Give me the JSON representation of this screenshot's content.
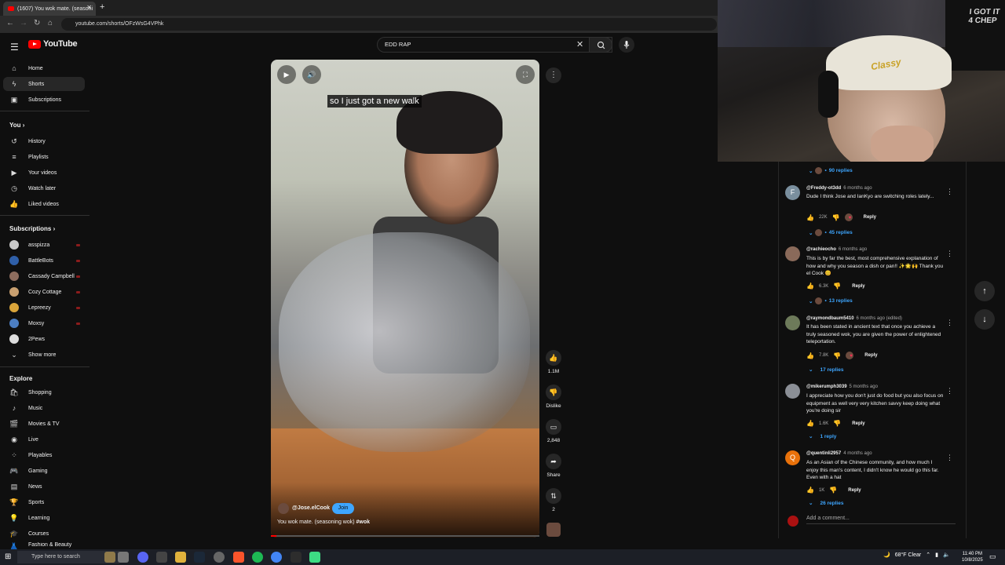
{
  "browser": {
    "tab_title": "(1607) You wok mate. (seasoni",
    "url": "youtube.com/shorts/OFzWsG4VPhk"
  },
  "sidebar": {
    "logo": "YouTube",
    "main": [
      {
        "label": "Home",
        "icon": "home-icon"
      },
      {
        "label": "Shorts",
        "icon": "shorts-icon"
      },
      {
        "label": "Subscriptions",
        "icon": "subscriptions-icon"
      }
    ],
    "you_heading": "You",
    "you": [
      {
        "label": "History",
        "icon": "history-icon"
      },
      {
        "label": "Playlists",
        "icon": "playlists-icon"
      },
      {
        "label": "Your videos",
        "icon": "your-videos-icon"
      },
      {
        "label": "Watch later",
        "icon": "watch-later-icon"
      },
      {
        "label": "Liked videos",
        "icon": "like-icon"
      }
    ],
    "subscriptions_heading": "Subscriptions",
    "subscriptions": [
      {
        "label": "asspizza",
        "color": "#c9c9c9"
      },
      {
        "label": "BattleBots",
        "color": "#2f5fa8"
      },
      {
        "label": "Cassady Campbell",
        "color": "#8e6d5e"
      },
      {
        "label": "Cozy Cottage",
        "color": "#c9a070"
      },
      {
        "label": "Lepreezy",
        "color": "#d9a43a"
      },
      {
        "label": "Moxsy",
        "color": "#4c7ec2"
      },
      {
        "label": "2Pews",
        "color": "#dddddd"
      }
    ],
    "show_more": "Show more",
    "explore_heading": "Explore",
    "explore": [
      {
        "label": "Shopping",
        "icon": "shopping-icon"
      },
      {
        "label": "Music",
        "icon": "music-icon"
      },
      {
        "label": "Movies & TV",
        "icon": "movies-icon"
      },
      {
        "label": "Live",
        "icon": "live-icon"
      },
      {
        "label": "Playables",
        "icon": "playables-icon"
      },
      {
        "label": "Gaming",
        "icon": "gaming-icon"
      },
      {
        "label": "News",
        "icon": "news-icon"
      },
      {
        "label": "Sports",
        "icon": "sports-icon"
      },
      {
        "label": "Learning",
        "icon": "learning-icon"
      },
      {
        "label": "Courses",
        "icon": "courses-icon"
      },
      {
        "label": "Fashion & Beauty",
        "icon": "fashion-icon"
      }
    ]
  },
  "search": {
    "value": "EDD RAP"
  },
  "video": {
    "caption": "so I just got a new walk",
    "channel": "@Jose.elCook",
    "join_label": "Join",
    "title": "You wok mate. (seasoning wok)",
    "hashtag": "#wok",
    "progress": 0.02
  },
  "actions": {
    "likes": "1.1M",
    "dislike": "Dislike",
    "comments": "2,848",
    "share": "Share",
    "remix": "2"
  },
  "comments": {
    "top_replies": "90 replies",
    "items": [
      {
        "user": "@Freddy-ot3dd",
        "time": "6 months ago",
        "text": "Dude I think Jose and IanKyo are switching roles lately...",
        "likes": "22K",
        "replies": "45 replies",
        "avatar_letter": "F",
        "avatar_color": "#7a8f9e",
        "hearted": true
      },
      {
        "user": "@rachieocho",
        "time": "6 months ago",
        "text": "This is by far the best, most comprehensive explanation of how and why you season a dish or pan!! ✨🌟🙌 Thank you el Cook 😊",
        "likes": "6.3K",
        "replies": "13 replies",
        "avatar_letter": "",
        "avatar_color": "#8a6a5a",
        "hearted": false
      },
      {
        "user": "@raymondbaum5410",
        "time": "6 months ago (edited)",
        "text": "It has been stated in ancient text that once you achieve a truly seasoned wok, you are given the power of enlightened teleportation.",
        "likes": "7.8K",
        "replies": "17 replies",
        "avatar_letter": "",
        "avatar_color": "#6d7a5a",
        "hearted": true
      },
      {
        "user": "@mikerumph3039",
        "time": "5 months ago",
        "text": "I appreciate how you don't just do food but you also focus on equipment as well very very kitchen savvy keep doing what you're doing sir",
        "likes": "1.6K",
        "replies": "1 reply",
        "avatar_letter": "",
        "avatar_color": "#8b8f96",
        "hearted": false
      },
      {
        "user": "@quentinli2957",
        "time": "4 months ago",
        "text": "As an Asian of the Chinese community, and how much I enjoy this man's content, I didn't know he would go this far. Even with a hat",
        "likes": "1K",
        "replies": "26 replies",
        "avatar_letter": "Q",
        "avatar_color": "#e8710a",
        "hearted": false
      }
    ],
    "reply_label": "Reply",
    "add_placeholder": "Add a comment..."
  },
  "webcam": {
    "cap_text": "Classy",
    "poster_text": "I GOT IT 4 CHEP"
  },
  "taskbar": {
    "search_placeholder": "Type here to search",
    "weather": "68°F  Clear",
    "time": "11:40 PM",
    "date": "10/8/2025"
  }
}
